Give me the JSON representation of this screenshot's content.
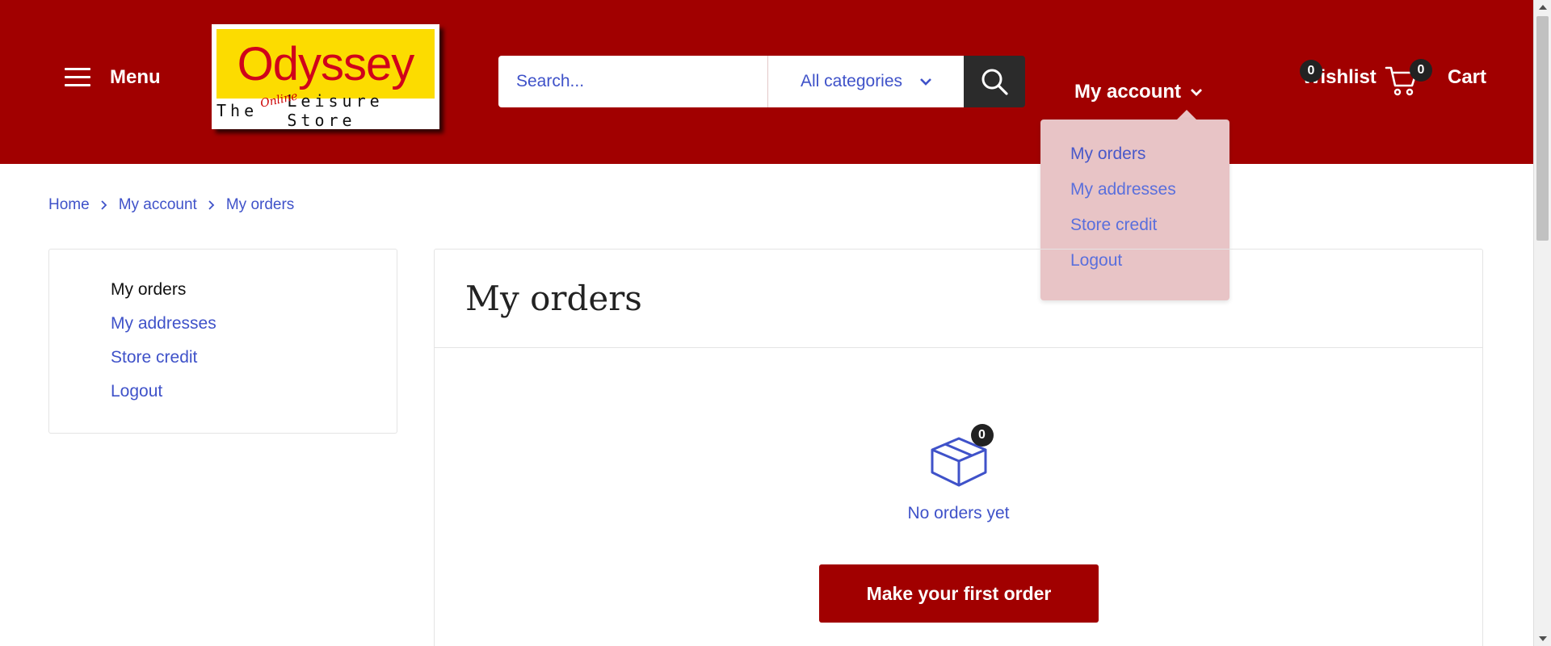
{
  "header": {
    "menu_label": "Menu",
    "logo": {
      "brand": "Odyssey",
      "tagline_left": "The",
      "tagline_script": "Online",
      "tagline_right": "Leisure Store"
    },
    "search": {
      "placeholder": "Search...",
      "category": "All categories"
    },
    "account_label": "My account",
    "wishlist_label": "Wishlist",
    "wishlist_count": "0",
    "cart_label": "Cart",
    "cart_count": "0"
  },
  "account_dropdown": {
    "items": [
      {
        "label": "My orders"
      },
      {
        "label": "My addresses"
      },
      {
        "label": "Store credit"
      },
      {
        "label": "Logout"
      }
    ]
  },
  "breadcrumb": {
    "items": [
      "Home",
      "My account",
      "My orders"
    ]
  },
  "sidebar": {
    "items": [
      {
        "label": "My orders"
      },
      {
        "label": "My addresses"
      },
      {
        "label": "Store credit"
      },
      {
        "label": "Logout"
      }
    ]
  },
  "main": {
    "title": "My orders",
    "empty_count": "0",
    "empty_text": "No orders yet",
    "cta_label": "Make your first order"
  },
  "colors": {
    "header_bg": "#a10000",
    "link": "#3f52c9",
    "dropdown_bg": "#e8c4c6",
    "logo_yellow": "#fcdc00",
    "logo_red": "#d0021b"
  },
  "icons": [
    "hamburger-icon",
    "search-icon",
    "chevron-down-icon",
    "cart-icon",
    "box-icon",
    "chevron-right-icon"
  ]
}
